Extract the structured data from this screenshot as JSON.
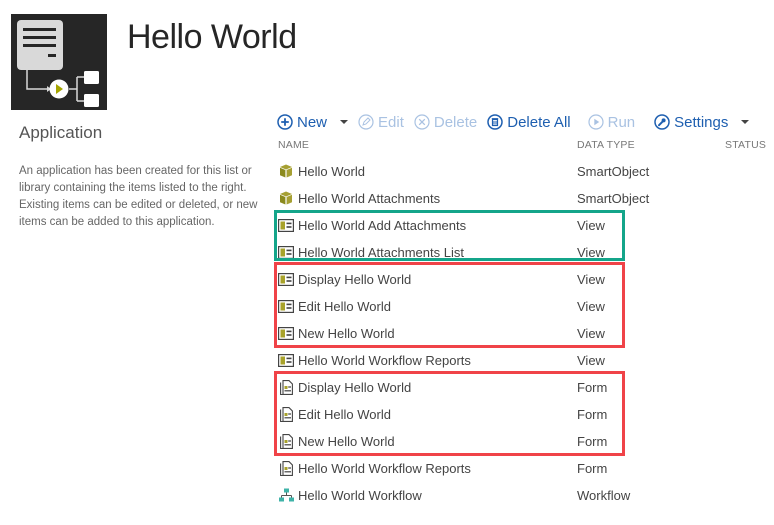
{
  "header": {
    "title": "Hello World",
    "logo_icon": "workflow-app-logo-icon"
  },
  "sidebar": {
    "heading": "Application",
    "description": "An application has been created for this list or library containing the items listed to the right. Existing items can be edited or deleted, or new items can be added to this application."
  },
  "toolbar": {
    "new_label": "New",
    "edit_label": "Edit",
    "delete_label": "Delete",
    "delete_all_label": "Delete All",
    "run_label": "Run",
    "settings_label": "Settings",
    "enabled_color": "#1e5fb0",
    "disabled_color": "#a9c2e2"
  },
  "table": {
    "columns": [
      "NAME",
      "DATA TYPE",
      "STATUS"
    ],
    "rows": [
      {
        "name": "Hello World",
        "type": "SmartObject",
        "icon": "smartobject-icon"
      },
      {
        "name": "Hello World Attachments",
        "type": "SmartObject",
        "icon": "smartobject-icon"
      },
      {
        "name": "Hello World Add Attachments",
        "type": "View",
        "icon": "view-icon"
      },
      {
        "name": "Hello World Attachments List",
        "type": "View",
        "icon": "view-icon"
      },
      {
        "name": "Display Hello World",
        "type": "View",
        "icon": "view-icon"
      },
      {
        "name": "Edit Hello World",
        "type": "View",
        "icon": "view-icon"
      },
      {
        "name": "New Hello World",
        "type": "View",
        "icon": "view-icon"
      },
      {
        "name": "Hello World Workflow Reports",
        "type": "View",
        "icon": "view-icon"
      },
      {
        "name": "Display Hello World",
        "type": "Form",
        "icon": "form-icon"
      },
      {
        "name": "Edit Hello World",
        "type": "Form",
        "icon": "form-icon"
      },
      {
        "name": "New Hello World",
        "type": "Form",
        "icon": "form-icon"
      },
      {
        "name": "Hello World Workflow Reports",
        "type": "Form",
        "icon": "form-icon"
      },
      {
        "name": "Hello World Workflow",
        "type": "Workflow",
        "icon": "workflow-icon"
      }
    ]
  },
  "highlights": [
    {
      "color": "#14a58a",
      "rows": [
        2,
        3
      ]
    },
    {
      "color": "#f04348",
      "rows": [
        4,
        5,
        6
      ]
    },
    {
      "color": "#f04348",
      "rows": [
        8,
        9,
        10
      ]
    }
  ]
}
